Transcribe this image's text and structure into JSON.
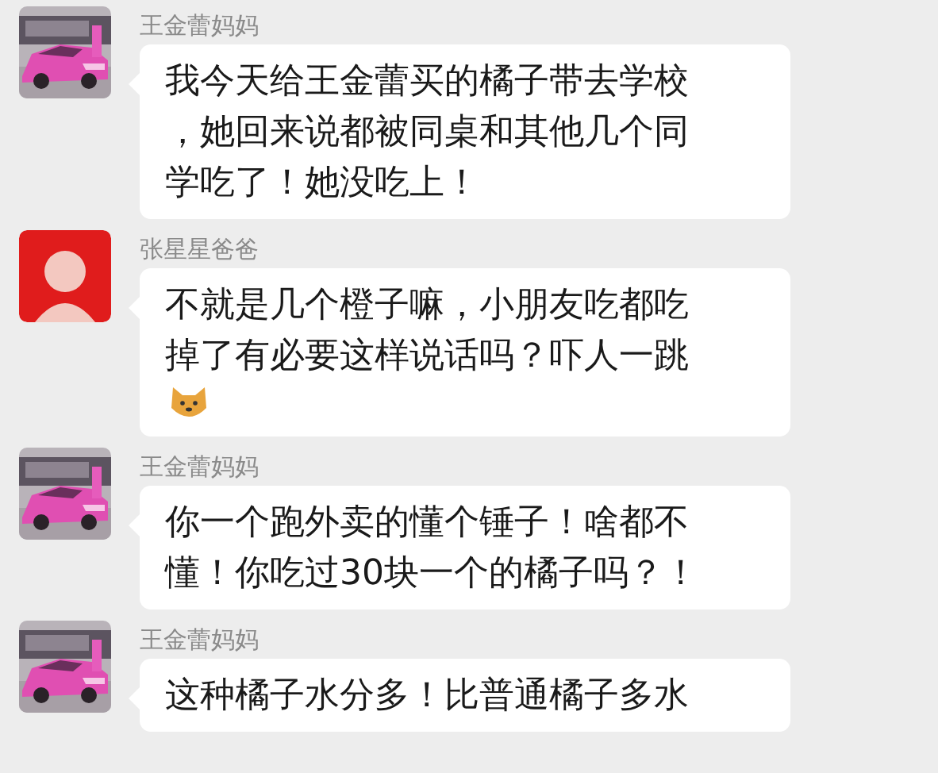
{
  "messages": [
    {
      "sender": "王金蕾妈妈",
      "avatar": {
        "kind": "picture"
      },
      "lines": [
        "我今天给王金蕾买的橘子带去学校",
        "，她回来说都被同桌和其他几个同",
        "学吃了！她没吃上！"
      ]
    },
    {
      "sender": "张星星爸爸",
      "avatar": {
        "kind": "icon"
      },
      "lines": [
        "不就是几个橙子嘛，小朋友吃都吃",
        "掉了有必要这样说话吗？吓人一跳"
      ],
      "emoji": true
    },
    {
      "sender": "王金蕾妈妈",
      "avatar": {
        "kind": "picture"
      },
      "lines": [
        "你一个跑外卖的懂个锤子！啥都不",
        "懂！你吃过30块一个的橘子吗？！"
      ]
    },
    {
      "sender": "王金蕾妈妈",
      "avatar": {
        "kind": "picture"
      },
      "lines": [
        "这种橘子水分多！比普通橘子多水"
      ]
    }
  ]
}
